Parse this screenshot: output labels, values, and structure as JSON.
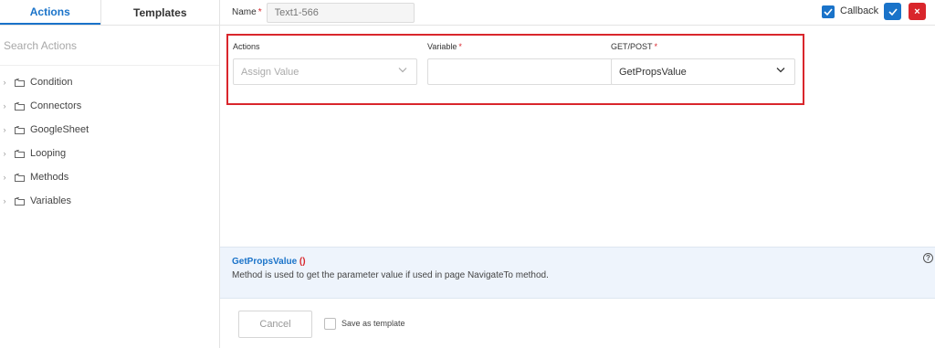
{
  "left_panel": {
    "tabs": [
      {
        "label": "Actions",
        "active": true
      },
      {
        "label": "Templates",
        "active": false
      }
    ],
    "search": {
      "placeholder": "Search Actions"
    },
    "tree": [
      {
        "label": "Condition"
      },
      {
        "label": "Connectors"
      },
      {
        "label": "GoogleSheet"
      },
      {
        "label": "Looping"
      },
      {
        "label": "Methods"
      },
      {
        "label": "Variables"
      }
    ]
  },
  "header": {
    "name_label": "Name",
    "required_mark": "*",
    "name_value": "Text1-566",
    "callback_label": "Callback",
    "callback_checked": true,
    "ok_icon": "check-icon",
    "close_icon": "close-icon",
    "close_glyph": "×"
  },
  "form": {
    "actions": {
      "label": "Actions",
      "placeholder": "Assign Value"
    },
    "variable": {
      "label": "Variable",
      "required_mark": "*",
      "value": ""
    },
    "getpost": {
      "label": "GET/POST",
      "required_mark": "*",
      "value": "GetPropsValue"
    }
  },
  "info": {
    "title": "GetPropsValue",
    "parens": "()",
    "description": "Method is used to get the parameter value if used in page NavigateTo method.",
    "help_glyph": "?"
  },
  "footer": {
    "cancel_label": "Cancel",
    "save_template_label": "Save as template"
  },
  "colors": {
    "accent": "#1a73c9",
    "danger": "#d9262c",
    "info_bg": "#eef4fc"
  }
}
